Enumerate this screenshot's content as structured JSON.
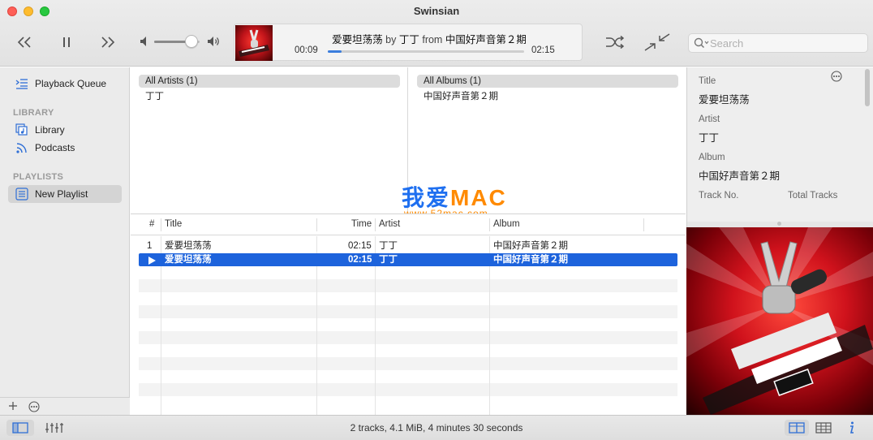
{
  "window": {
    "title": "Swinsian"
  },
  "player": {
    "elapsed": "00:09",
    "remaining": "02:15",
    "progress": 0.07,
    "volume": 0.82,
    "track_title": "爱要坦荡荡",
    "by_word": "by",
    "artist": "丁丁",
    "from_word": "from",
    "album": "中国好声音第２期"
  },
  "search": {
    "placeholder": "Search"
  },
  "sidebar": {
    "playback_queue": "Playback Queue",
    "library_header": "LIBRARY",
    "library_items": [
      {
        "label": "Library"
      },
      {
        "label": "Podcasts"
      }
    ],
    "playlists_header": "PLAYLISTS",
    "playlists": [
      {
        "label": "New Playlist",
        "selected": true
      }
    ]
  },
  "browser": {
    "artists": {
      "header": "All Artists (1)",
      "items": [
        "丁丁"
      ]
    },
    "albums": {
      "header": "All Albums (1)",
      "items": [
        "中国好声音第２期"
      ]
    }
  },
  "watermark": {
    "main_blue": "我爱",
    "main_orange": "MAC",
    "sub": "www.52mac.com"
  },
  "table": {
    "columns": {
      "num": "#",
      "title": "Title",
      "time": "Time",
      "artist": "Artist",
      "album": "Album"
    },
    "rows": [
      {
        "num": "1",
        "title": "爱要坦荡荡",
        "time": "02:15",
        "artist": "丁丁",
        "album": "中国好声音第２期",
        "playing": false,
        "selected": false
      },
      {
        "num": "",
        "title": "爱要坦荡荡",
        "time": "02:15",
        "artist": "丁丁",
        "album": "中国好声音第２期",
        "playing": true,
        "selected": true
      }
    ]
  },
  "info": {
    "title_label": "Title",
    "title_value": "爱要坦荡荡",
    "artist_label": "Artist",
    "artist_value": "丁丁",
    "album_label": "Album",
    "album_value": "中国好声音第２期",
    "track_no_label": "Track No.",
    "total_tracks_label": "Total Tracks"
  },
  "status": {
    "summary": "2 tracks,  4.1 MiB,  4 minutes 30 seconds"
  },
  "colors": {
    "accent": "#1d63dc",
    "watermark_blue": "#1e6ff0",
    "watermark_orange": "#ff8a00"
  }
}
